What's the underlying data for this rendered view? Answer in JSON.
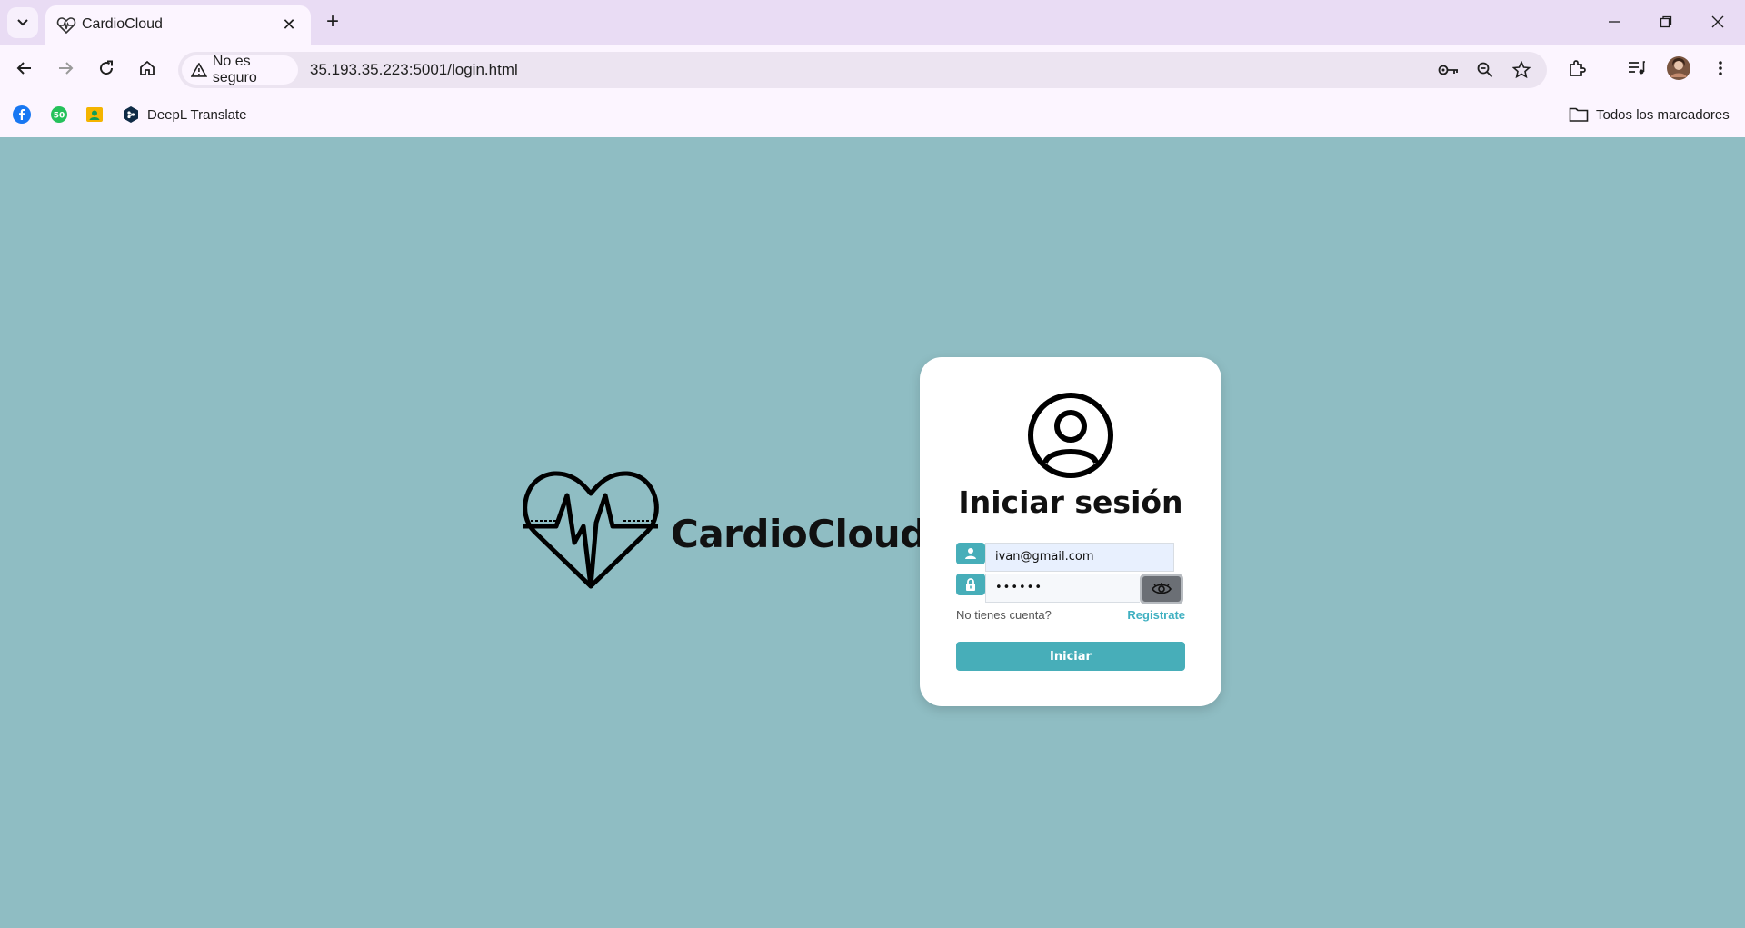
{
  "browser": {
    "tab_title": "CardioCloud",
    "security_label": "No es seguro",
    "url": "35.193.35.223:5001/login.html",
    "bookmarks": [
      {
        "label": "",
        "icon": "facebook-icon"
      },
      {
        "label": "",
        "icon": "whatsapp-50-icon"
      },
      {
        "label": "",
        "icon": "contacts-icon"
      },
      {
        "label": "DeepL Translate",
        "icon": "deepl-icon"
      }
    ],
    "all_bookmarks_label": "Todos los marcadores"
  },
  "brand": {
    "name": "CardioCloud",
    "logo_icon": "heart-pulse-icon"
  },
  "login": {
    "title": "Iniciar sesión",
    "email_value": "ivan@gmail.com",
    "password_value": "••••••",
    "no_account_text": "No tienes cuenta?",
    "register_link": "Registrate",
    "submit_label": "Iniciar"
  },
  "colors": {
    "page_background": "#8fbdc3",
    "accent": "#47aeb9",
    "link": "#3fb0c1",
    "tabbar": "#e9dcf4"
  }
}
